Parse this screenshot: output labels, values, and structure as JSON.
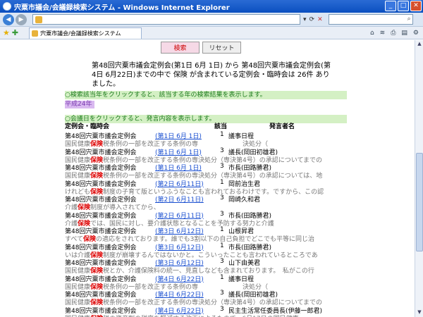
{
  "window": {
    "title": "宍粟市議会/会議録検索システム - Windows Internet Explorer"
  },
  "tab": {
    "label": "宍粟市議会/会議録検索システム"
  },
  "buttons": {
    "search": "検索",
    "reset": "リセット"
  },
  "summary": "第48回宍粟市議会定例会(第1日 6月 1日) から 第48回宍粟市議会定例会(第4日 6月22日)までの中で 保険 が含まれている定例会・臨時会は 26件 ありました。",
  "info_year": "○検索該当年をクリックすると、該当する年の検索結果を表示します。",
  "year_link": "平成24年",
  "info_day": "○会議日をクリックすると、発言内容を表示します。",
  "header": {
    "meeting": "定例会・臨時会",
    "hit": "該当",
    "speaker": "発言者名"
  },
  "keyword": "保険",
  "rows": [
    {
      "meeting": "第48回宍粟市議会定例会",
      "date": "(第1日 6月 1日)",
      "num": "1",
      "speaker": "議事日程",
      "pre": "国民健康",
      "post": "税条例の一部を改正する条例の専　　　　　　　決処分（"
    },
    {
      "meeting": "第48回宍粟市議会定例会",
      "date": "(第1日 6月 1日)",
      "num": "3",
      "speaker": "議長(岡田初雄君)",
      "pre": "国民健康",
      "post": "税条例の一部を改正する条例の専決処分（専決第4号）の承認についてまでの"
    },
    {
      "meeting": "第48回宍粟市議会定例会",
      "date": "(第1日 6月 1日)",
      "num": "3",
      "speaker": "市長(田路勝君)",
      "pre": "国民健康",
      "post": "税条例の一部を改正する条例の専決処分（専決第4号）の承認については、地"
    },
    {
      "meeting": "第48回宍粟市議会定例会",
      "date": "(第2日 6月11日)",
      "num": "1",
      "speaker": "岡前治生君",
      "pre": "けれども",
      "post": "制度の子育て版というふうなことも言われておるわけです。ですから、この認"
    },
    {
      "meeting": "第48回宍粟市議会定例会",
      "date": "(第2日 6月11日)",
      "num": "3",
      "speaker": "岡崎久和君",
      "pre": "介護",
      "post": "制度が導入されてから、"
    },
    {
      "meeting": "第48回宍粟市議会定例会",
      "date": "(第2日 6月11日)",
      "num": "3",
      "speaker": "市長(田路勝君)",
      "pre": "介護",
      "post": "では、国民に対し、要介護状態となることを予防する努力と介護"
    },
    {
      "meeting": "第48回宍粟市議会定例会",
      "date": "(第3日 6月12日)",
      "num": "1",
      "speaker": "山根昇君",
      "pre": "すべて",
      "post": "の適応をされております。誰でも3割以下の自己負担でどこでも平等に同じ治"
    },
    {
      "meeting": "第48回宍粟市議会定例会",
      "date": "(第3日 6月12日)",
      "num": "1",
      "speaker": "市長(田路勝君)",
      "pre": "いは介護",
      "post": "制度が崩壊するんではないかと。こういったことも言われているところであ"
    },
    {
      "meeting": "第48回宍粟市議会定例会",
      "date": "(第3日 6月12日)",
      "num": "3",
      "speaker": "山下由美君",
      "pre": "国民健康",
      "post": "税とか、介護保険料の統一、見直しなども含まれております。　私がこの行"
    },
    {
      "meeting": "第48回宍粟市議会定例会",
      "date": "(第4日 6月22日)",
      "num": "1",
      "speaker": "議事日程",
      "pre": "国民健康",
      "post": "税条例の一部を改正する条例の専　　　　　　　決処分（"
    },
    {
      "meeting": "第48回宍粟市議会定例会",
      "date": "(第4日 6月22日)",
      "num": "3",
      "speaker": "議長(岡田初雄君)",
      "pre": "国民健康",
      "post": "税条例の一部を改正する条例の専決処分（専決第4号）の承認についてまでの"
    },
    {
      "meeting": "第48回宍粟市議会定例会",
      "date": "(第4日 6月22日)",
      "num": "3",
      "speaker": "民主生活常任委員長(伊藤一郎君)",
      "pre": "国民健康",
      "post": "税の資産割の税率を軽減する改正によるもので、6月17日の国民健康"
    }
  ]
}
